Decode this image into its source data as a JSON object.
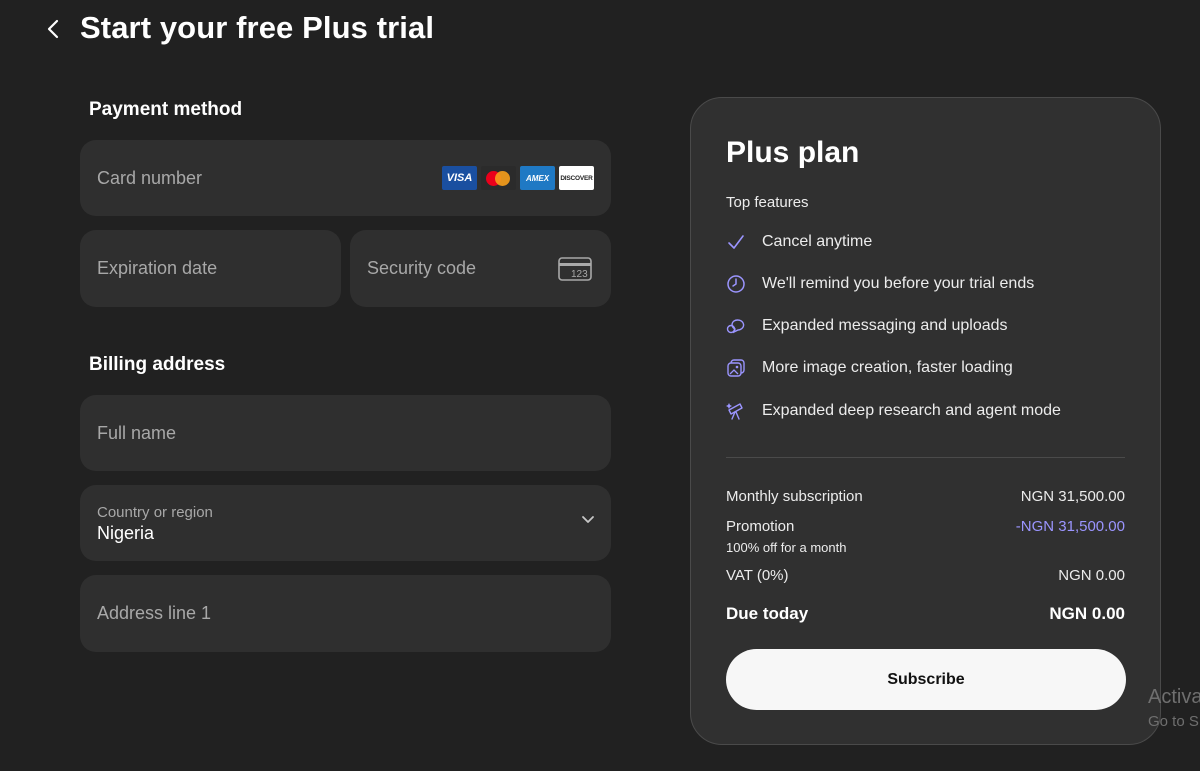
{
  "header": {
    "title": "Start your free Plus trial"
  },
  "payment": {
    "section_title": "Payment method",
    "card_number_placeholder": "Card number",
    "card_logos": {
      "visa": "VISA",
      "amex": "AMEX",
      "discover": "DISCOVER"
    },
    "expiration_placeholder": "Expiration date",
    "security_placeholder": "Security code",
    "security_icon_text": "123"
  },
  "billing": {
    "section_title": "Billing address",
    "full_name_placeholder": "Full name",
    "country_label": "Country or region",
    "country_value": "Nigeria",
    "address_placeholder": "Address line 1"
  },
  "plan": {
    "title": "Plus plan",
    "features_heading": "Top features",
    "features": [
      {
        "icon": "check-icon",
        "label": "Cancel anytime"
      },
      {
        "icon": "clock-icon",
        "label": "We'll remind you before your trial ends"
      },
      {
        "icon": "chat-bubbles-icon",
        "label": "Expanded messaging and uploads"
      },
      {
        "icon": "image-icon",
        "label": "More image creation, faster loading"
      },
      {
        "icon": "telescope-icon",
        "label": "Expanded deep research and agent mode"
      }
    ],
    "summary": {
      "monthly_label": "Monthly subscription",
      "monthly_value": "NGN 31,500.00",
      "promo_label": "Promotion",
      "promo_value": "-NGN 31,500.00",
      "promo_note": "100% off for a month",
      "vat_label": "VAT (0%)",
      "vat_value": "NGN 0.00",
      "due_label": "Due today",
      "due_value": "NGN 0.00"
    },
    "subscribe_label": "Subscribe"
  },
  "watermark": {
    "line1": "Activa",
    "line2": "Go to S"
  },
  "colors": {
    "background": "#212121",
    "field": "#2f2f2f",
    "card": "#303030",
    "accent": "#9b95ff"
  }
}
